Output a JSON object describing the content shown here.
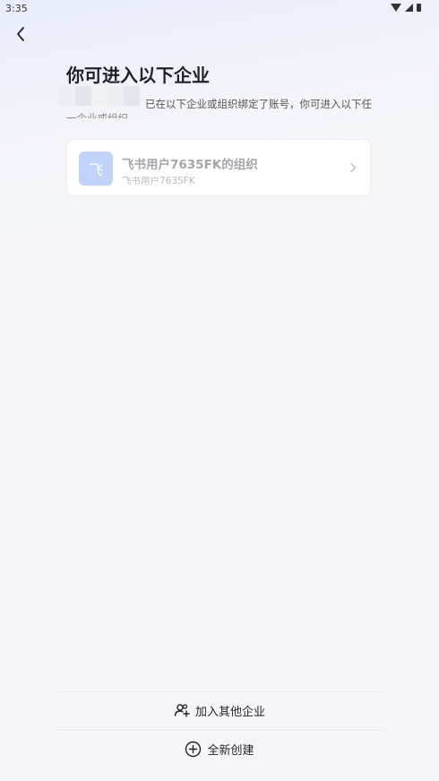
{
  "status_bar": {
    "time": "3:35"
  },
  "page": {
    "title": "你可进入以下企业",
    "subtitle": "已在以下企业或组织绑定了账号，你可进入以下任",
    "subtitle_wrap": "一企业或组织"
  },
  "organizations": [
    {
      "avatar_text": "飞",
      "name": "飞书用户7635FK的组织",
      "id": "飞书用户7635FK"
    }
  ],
  "actions": {
    "join_other": "加入其他企业",
    "create_new": "全新创建"
  },
  "colors": {
    "accent_avatar": "#c2d3fb",
    "background": "#f6f6f8"
  }
}
